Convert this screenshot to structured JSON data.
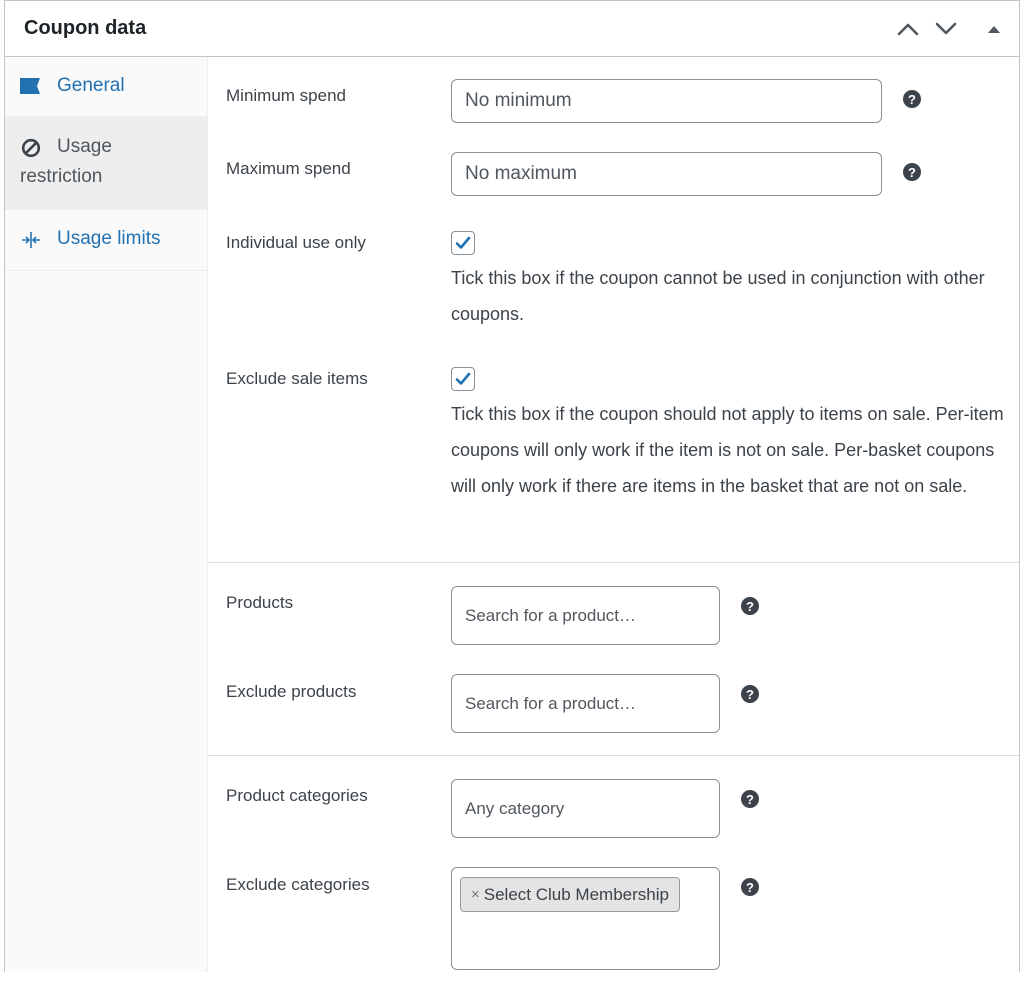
{
  "header": {
    "title": "Coupon data"
  },
  "tabs": [
    {
      "label": "General"
    },
    {
      "label": "Usage restriction"
    },
    {
      "label": "Usage limits"
    }
  ],
  "fields": {
    "minimum_spend": {
      "label": "Minimum spend",
      "placeholder": "No minimum"
    },
    "maximum_spend": {
      "label": "Maximum spend",
      "placeholder": "No maximum"
    },
    "individual_use": {
      "label": "Individual use only",
      "checked": true,
      "description": "Tick this box if the coupon cannot be used in conjunction with other coupons."
    },
    "exclude_sale": {
      "label": "Exclude sale items",
      "checked": true,
      "description": "Tick this box if the coupon should not apply to items on sale. Per-item coupons will only work if the item is not on sale. Per-basket coupons will only work if there are items in the basket that are not on sale."
    },
    "products": {
      "label": "Products",
      "placeholder": "Search for a product…"
    },
    "exclude_products": {
      "label": "Exclude products",
      "placeholder": "Search for a product…"
    },
    "product_categories": {
      "label": "Product categories",
      "placeholder": "Any category"
    },
    "exclude_categories": {
      "label": "Exclude categories",
      "selected": [
        "Select Club Membership"
      ],
      "remove_symbol": "×"
    }
  },
  "help_symbol": "?",
  "colors": {
    "link": "#2271b1",
    "checkmark": "#2271b1",
    "active_tab_bg": "#eeeeee"
  }
}
